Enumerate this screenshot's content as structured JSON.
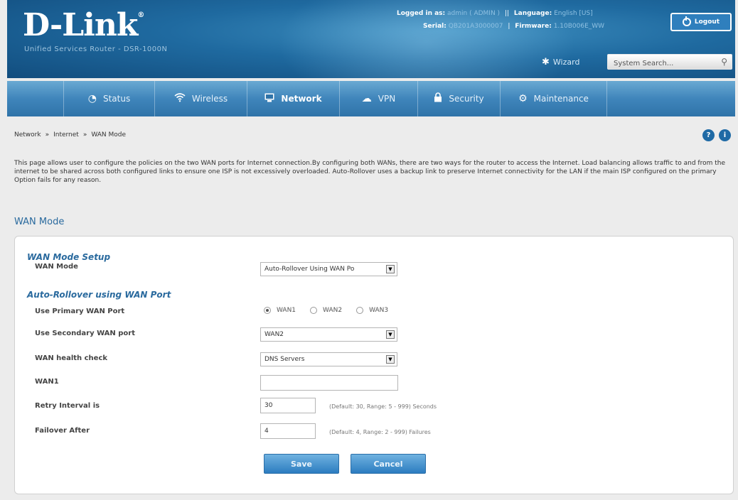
{
  "header": {
    "brand": "D-Link",
    "registered_mark": "®",
    "subtitle": "Unified Services Router - DSR-1000N",
    "logged_in_label": "Logged in as:",
    "logged_in_value": "admin ( ADMIN )",
    "language_label": "Language:",
    "language_value": "English [US]",
    "serial_label": "Serial:",
    "serial_value": "QB201A3000007",
    "firmware_label": "Firmware:",
    "firmware_value": "1.10B006E_WW",
    "logout_label": "Logout",
    "wizard_label": "Wizard",
    "search_placeholder": "System Search..."
  },
  "nav": {
    "items": [
      {
        "label": "Status",
        "icon": "dashboard-icon"
      },
      {
        "label": "Wireless",
        "icon": "wifi-icon"
      },
      {
        "label": "Network",
        "icon": "network-icon",
        "active": true
      },
      {
        "label": "VPN",
        "icon": "cloud-icon"
      },
      {
        "label": "Security",
        "icon": "lock-icon"
      },
      {
        "label": "Maintenance",
        "icon": "gears-icon"
      }
    ]
  },
  "breadcrumb": [
    "Network",
    "Internet",
    "WAN Mode"
  ],
  "breadcrumb_sep": "»",
  "help_label": "?",
  "info_label": "i",
  "description": "This page allows user to configure the policies on the two WAN ports for Internet connection.By configuring both WANs, there are two ways for the router to access the Internet. Load balancing allows traffic to and from the internet to be shared across both configured links to ensure one ISP is not excessively overloaded. Auto-Rollover uses a backup link to preserve Internet connectivity for the LAN if the main ISP configured on the primary Option fails for any reason.",
  "section_title": "WAN Mode",
  "form": {
    "group1_title": "WAN Mode Setup",
    "wan_mode_label": "WAN Mode",
    "wan_mode_value": "Auto-Rollover Using WAN Po",
    "group2_title": "Auto-Rollover using WAN Port",
    "primary_label": "Use Primary WAN Port",
    "primary_options": [
      "WAN1",
      "WAN2",
      "WAN3"
    ],
    "primary_selected": "WAN1",
    "secondary_label": "Use Secondary WAN port",
    "secondary_value": "WAN2",
    "health_label": "WAN health check",
    "health_value": "DNS Servers",
    "wan1_label": "WAN1",
    "wan1_value": "",
    "retry_label": "Retry Interval is",
    "retry_value": "30",
    "retry_hint": "(Default: 30, Range: 5 - 999) Seconds",
    "failover_label": "Failover After",
    "failover_value": "4",
    "failover_hint": "(Default: 4, Range: 2 - 999) Failures",
    "save_label": "Save",
    "cancel_label": "Cancel"
  },
  "colors": {
    "header_blue": "#1f6aa0",
    "nav_blue": "#3f85bb",
    "accent_text": "#2a6a9e"
  }
}
